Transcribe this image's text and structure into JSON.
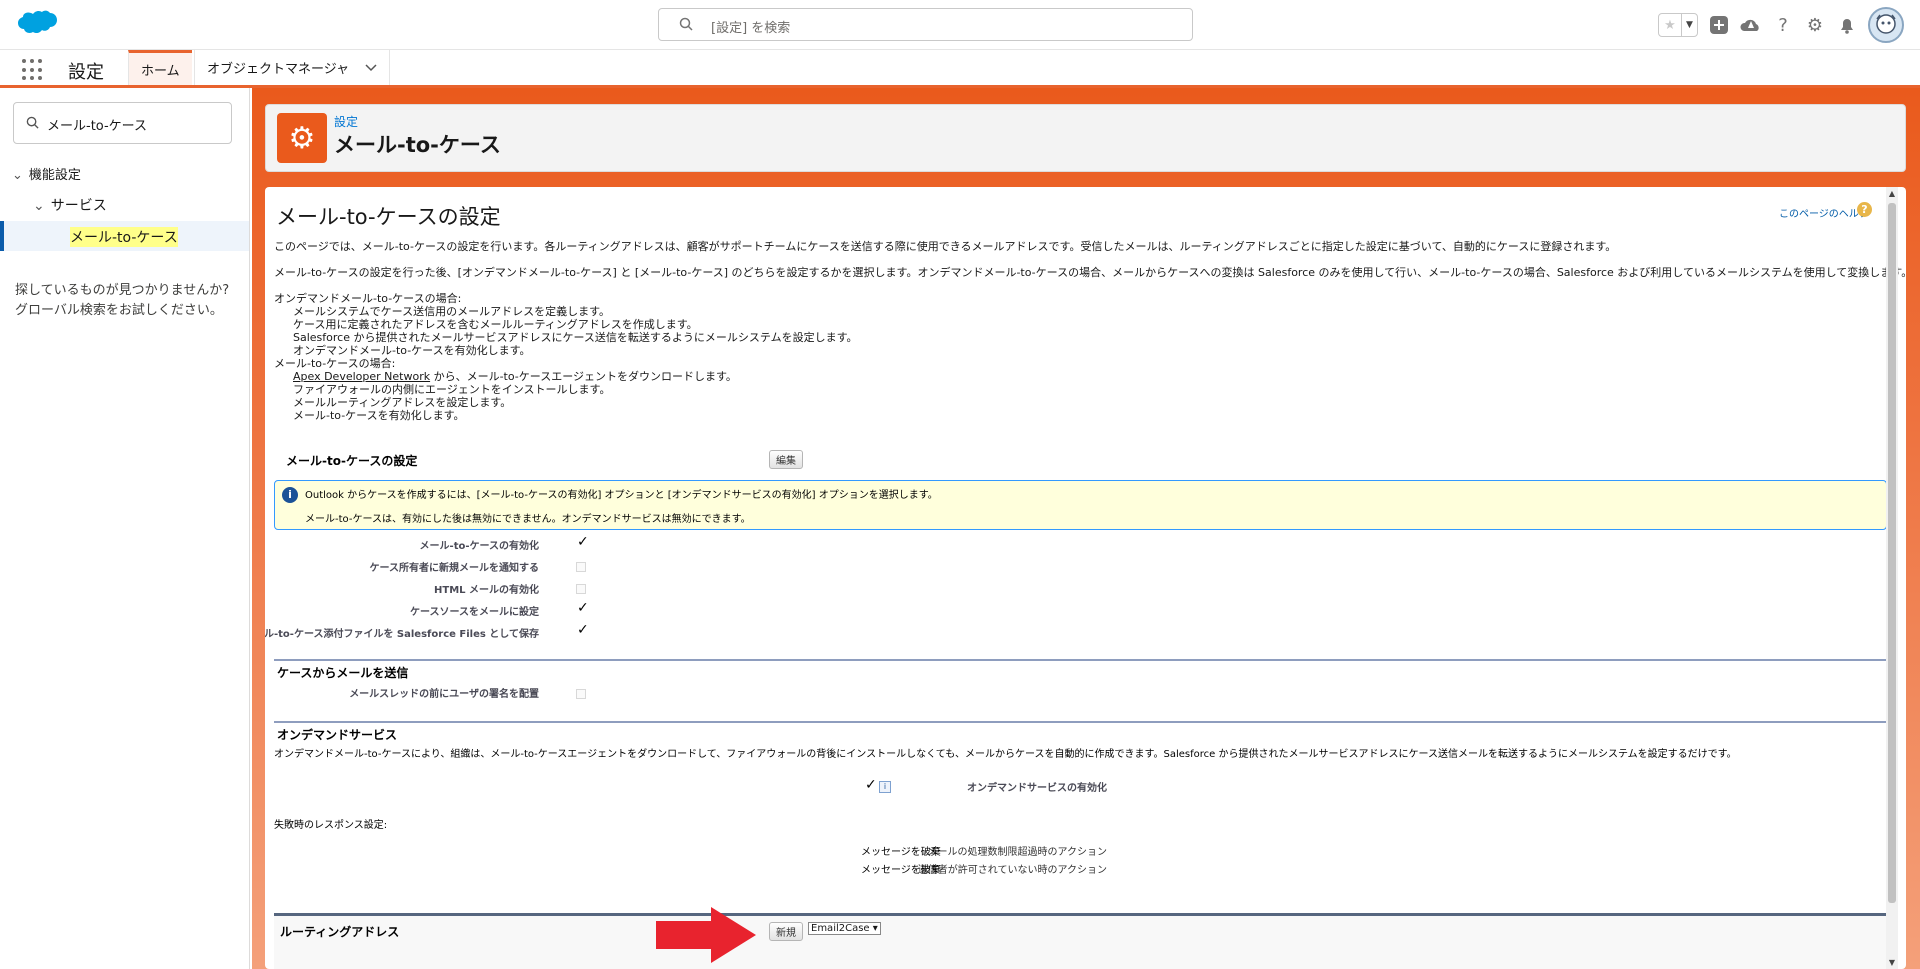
{
  "header": {
    "search_placeholder": "[設定] を検索"
  },
  "nav": {
    "app_name": "設定",
    "tabs": [
      {
        "label": "ホーム"
      },
      {
        "label": "オブジェクトマネージャ"
      }
    ]
  },
  "sidebar": {
    "quick_find_value": "メール-to-ケース",
    "tree": [
      "機能設定",
      "サービス",
      "メール-to-ケース"
    ],
    "not_found_line1": "探しているものが見つかりませんか?",
    "not_found_line2": "グローバル検索をお試しください。"
  },
  "page_header": {
    "breadcrumb": "設定",
    "title": "メール-to-ケース"
  },
  "content": {
    "title": "メール-to-ケースの設定",
    "help_link": "このページのヘルプ",
    "intro1": "このページでは、メール-to-ケースの設定を行います。各ルーティングアドレスは、顧客がサポートチームにケースを送信する際に使用できるメールアドレスです。受信したメールは、ルーティングアドレスごとに指定した設定に基づいて、自動的にケースに登録されます。",
    "intro2": "メール-to-ケースの設定を行った後、[オンデマンドメール-to-ケース] と [メール-to-ケース] のどちらを設定するかを選択します。オンデマンドメール-to-ケースの場合、メールからケースへの変換は Salesforce のみを使用して行い、メール-to-ケースの場合、Salesforce および利用しているメールシステムを使用して変換します。",
    "ondemand_heading": "オンデマンドメール-to-ケースの場合:",
    "ondemand_steps": [
      "メールシステムでケース送信用のメールアドレスを定義します。",
      "ケース用に定義されたアドレスを含むメールルーティングアドレスを作成します。",
      "Salesforce から提供されたメールサービスアドレスにケース送信を転送するようにメールシステムを設定します。",
      "オンデマンドメール-to-ケースを有効化します。"
    ],
    "e2c_heading": "メール-to-ケースの場合:",
    "e2c_step1_link": "Apex Developer Network",
    "e2c_step1_rest": " から、メール-to-ケースエージェントをダウンロードします。",
    "e2c_steps": [
      "ファイアウォールの内側にエージェントをインストールします。",
      "メールルーティングアドレスを設定します。",
      "メール-to-ケースを有効化します。"
    ],
    "settings_section": "メール-to-ケースの設定",
    "edit_button": "編集",
    "info_line1": "Outlook からケースを作成するには、[メール-to-ケースの有効化] オプションと [オンデマンドサービスの有効化] オプションを選択します。",
    "info_line2": "メール-to-ケースは、有効にした後は無効にできません。オンデマンドサービスは無効にできます。",
    "fields": [
      {
        "label": "メール-to-ケースの有効化",
        "checked": true
      },
      {
        "label": "ケース所有者に新規メールを通知する",
        "checked": false
      },
      {
        "label": "HTML メールの有効化",
        "checked": false
      },
      {
        "label": "ケースソースをメールに設定",
        "checked": true
      },
      {
        "label": "メール-to-ケース添付ファイルを Salesforce Files として保存",
        "checked": true
      }
    ],
    "send_section": "ケースからメールを送信",
    "send_field": "メールスレッドの前にユーザの署名を配置",
    "ondemand_section": "オンデマンドサービス",
    "ondemand_desc": "オンデマンドメール-to-ケースにより、組織は、メール-to-ケースエージェントをダウンロードして、ファイアウォールの背後にインストールしなくても、メールからケースを自動的に作成できます。Salesforce から提供されたメールサービスアドレスにケース送信メールを転送するようにメールシステムを設定するだけです。",
    "ondemand_enable_label": "オンデマンドサービスの有効化",
    "failure_heading": "失敗時のレスポンス設定:",
    "failure_rows": [
      {
        "label": "メールの処理数制限超過時のアクション",
        "value": "メッセージを破棄"
      },
      {
        "label": "送信者が許可されていない時のアクション",
        "value": "メッセージを破棄"
      }
    ],
    "routing_section": "ルーティングアドレス",
    "new_button": "新規",
    "routing_select": "Email2Case"
  },
  "colors": {
    "accent": "#ea5a1c",
    "link": "#0176d3",
    "arrow": "#e8232e"
  }
}
